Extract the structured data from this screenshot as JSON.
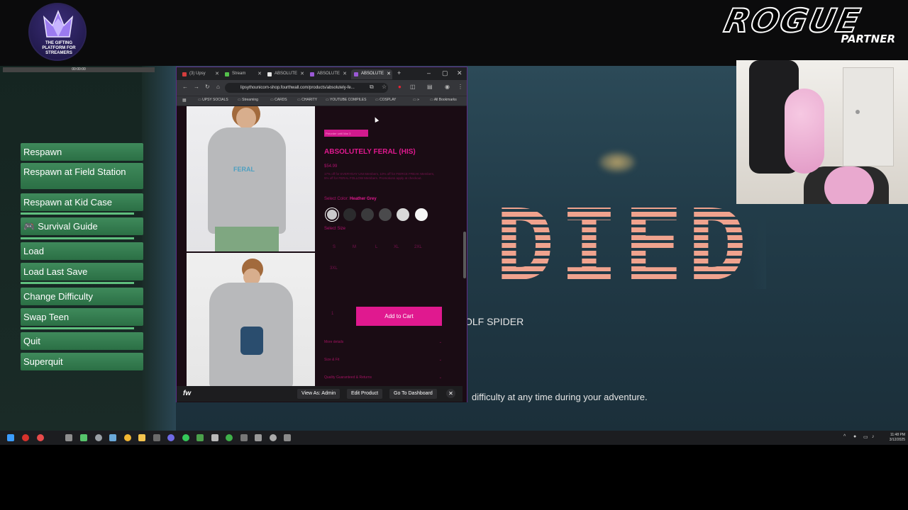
{
  "platform_logo": {
    "icon": "crown-gem-icon",
    "caption_line1": "THE GIFTING",
    "caption_line2": "PLATFORM FOR",
    "caption_line3": "STREAMERS"
  },
  "partner_badge": {
    "title": "ROGUE",
    "subtitle": "PARTNER"
  },
  "mini_bar": {
    "label": "00:00:00"
  },
  "game_menu": {
    "items": [
      {
        "label": "Respawn"
      },
      {
        "label": "Respawn at Field Station"
      },
      {
        "label": "Respawn at Kid Case"
      },
      {
        "label": "Survival Guide",
        "icon": "gamepad-icon"
      },
      {
        "label": "Load"
      },
      {
        "label": "Load Last Save"
      },
      {
        "label": "Change Difficulty"
      },
      {
        "label": "Swap Teen"
      },
      {
        "label": "Quit"
      },
      {
        "label": "Superquit"
      }
    ]
  },
  "death_screen": {
    "title": "DIED",
    "cause": "OLF SPIDER",
    "tip": "difficulty at any time during your adventure."
  },
  "browser": {
    "tabs": [
      {
        "label": "(3) Upsy",
        "color": "#d43d3d"
      },
      {
        "label": "Stream",
        "color": "#53c04b"
      },
      {
        "label": "ABSOLUTE",
        "color": "#e6e6e6"
      },
      {
        "label": "ABSOLUTE",
        "color": "#9b59d6"
      },
      {
        "label": "ABSOLUTE",
        "color": "#9b59d6"
      }
    ],
    "new_tab": "+",
    "url": "lipsythounicorn-shop.fourthwall.com/products/absolutely-fe...",
    "bookmarks": [
      "UPSY SOCIALS",
      "Streaming",
      "CARDS",
      "CHARITY",
      "YOUTUBE COMPILES",
      "COSPLAY",
      "»",
      "All Bookmarks"
    ]
  },
  "product": {
    "badge": "Preorder until Mar 3",
    "title": "ABSOLUTELY FERAL (HIS)",
    "price": "$54.99",
    "promo": "17% off for EVERYDAY UNI Members, 10% off for FIERCE FREAK Members, 5% off for FERAL FOLLOW Members. Promotions apply at checkout.",
    "color_label": "Select Color:",
    "color_value": "Heather Grey",
    "swatches": [
      "#c9c9cb",
      "#2b2b2d",
      "#3a3a3c",
      "#4a4a4c",
      "#d9d9d9",
      "#f5f5f5"
    ],
    "size_label": "Select Size",
    "sizes": [
      "S",
      "M",
      "L",
      "XL",
      "2XL",
      "3XL"
    ],
    "quantity": "1",
    "add_to_cart": "Add to Cart",
    "accordions": [
      "More details",
      "Size & Fit",
      "Quality Guaranteed & Returns"
    ],
    "hoodie_print": "FERAL"
  },
  "admin_bar": {
    "logo": "fw",
    "view_as": "View As: Admin",
    "edit_product": "Edit Product",
    "dashboard": "Go To Dashboard"
  },
  "taskbar": {
    "time": "11:48 PM",
    "date": "3/12/2025",
    "icons": [
      "windows-icon",
      "app-red-icon",
      "app-target-icon",
      "search-icon",
      "chat-icon",
      "settings-icon",
      "app-feather-icon",
      "chrome-icon",
      "folder-icon",
      "app-game-icon",
      "app-discord-icon",
      "spotify-icon",
      "app-green-icon",
      "app-obs-icon",
      "xbox-icon",
      "app-gray-icon",
      "app-gear-icon",
      "app-box-icon",
      "app-steam-icon"
    ]
  }
}
